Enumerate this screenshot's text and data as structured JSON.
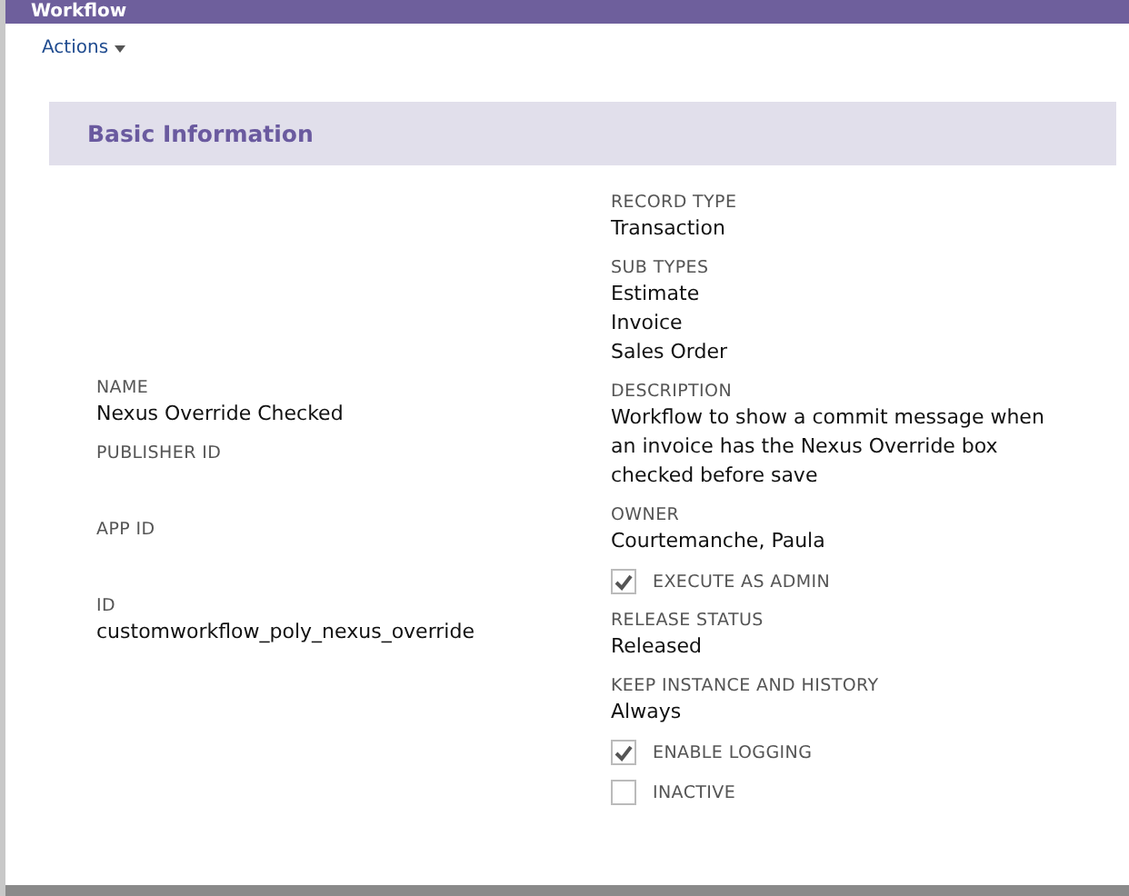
{
  "window": {
    "title": "Workflow"
  },
  "actions_menu": {
    "label": "Actions"
  },
  "section": {
    "title": "Basic Information"
  },
  "left_fields": [
    {
      "kind": "field",
      "label": "NAME",
      "values": [
        "Nexus Override Checked"
      ]
    },
    {
      "kind": "field",
      "label": "PUBLISHER ID"
    },
    {
      "kind": "field",
      "label": "APP ID"
    },
    {
      "kind": "field",
      "label": "ID",
      "values": [
        "customworkflow_poly_nexus_override"
      ]
    }
  ],
  "right_fields": [
    {
      "kind": "field",
      "label": "RECORD TYPE",
      "values": [
        "Transaction"
      ]
    },
    {
      "kind": "field",
      "label": "SUB TYPES",
      "values": [
        "Estimate",
        "Invoice",
        "Sales Order"
      ]
    },
    {
      "kind": "field",
      "label": "DESCRIPTION",
      "values": [
        "Workflow to show a commit message when an invoice has the Nexus Override box checked before save"
      ]
    },
    {
      "kind": "field",
      "label": "OWNER",
      "values": [
        "Courtemanche, Paula"
      ]
    },
    {
      "kind": "checkbox",
      "label": "EXECUTE AS ADMIN",
      "checked": true
    },
    {
      "kind": "field",
      "label": "RELEASE STATUS",
      "values": [
        "Released"
      ]
    },
    {
      "kind": "field",
      "label": "KEEP INSTANCE AND HISTORY",
      "values": [
        "Always"
      ]
    },
    {
      "kind": "checkbox",
      "label": "ENABLE LOGGING",
      "checked": true
    },
    {
      "kind": "checkbox",
      "label": "INACTIVE",
      "checked": false
    }
  ]
}
